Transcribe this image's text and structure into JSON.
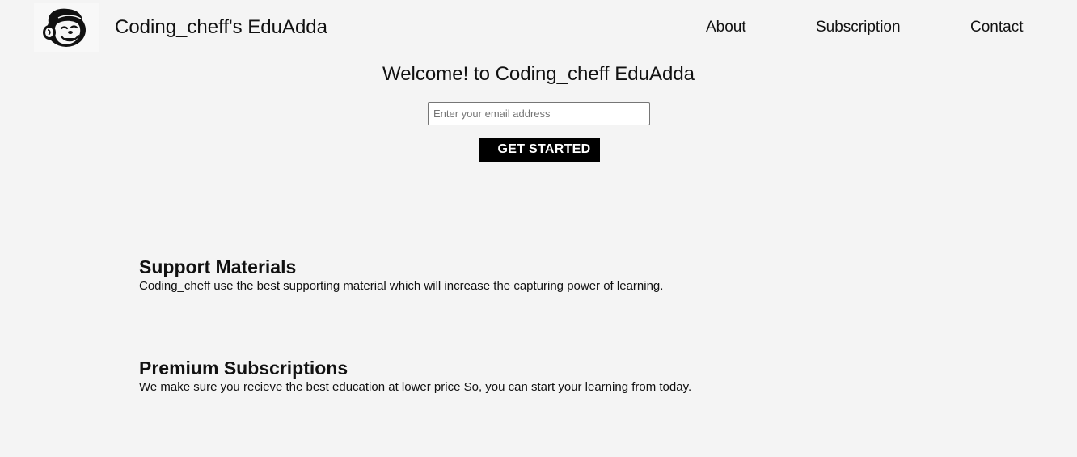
{
  "header": {
    "logo_icon": "monkey-mascot-icon",
    "brand": "Coding_cheff's EduAdda",
    "nav": [
      {
        "label": "About"
      },
      {
        "label": "Subscription"
      },
      {
        "label": "Contact"
      }
    ]
  },
  "hero": {
    "title": "Welcome! to Coding_cheff EduAdda",
    "email_placeholder": "Enter your email address",
    "email_value": "",
    "button_label": "GET STARTED"
  },
  "features": [
    {
      "title": "Support Materials",
      "text": "Coding_cheff use the best supporting material which will increase the capturing power of learning."
    },
    {
      "title": "Premium Subscriptions",
      "text": "We make sure you recieve the best education at lower price So, you can start your learning from today."
    }
  ],
  "colors": {
    "background": "#f4f4f4",
    "button": "#000000",
    "button_text": "#ffffff",
    "text": "#111111"
  }
}
